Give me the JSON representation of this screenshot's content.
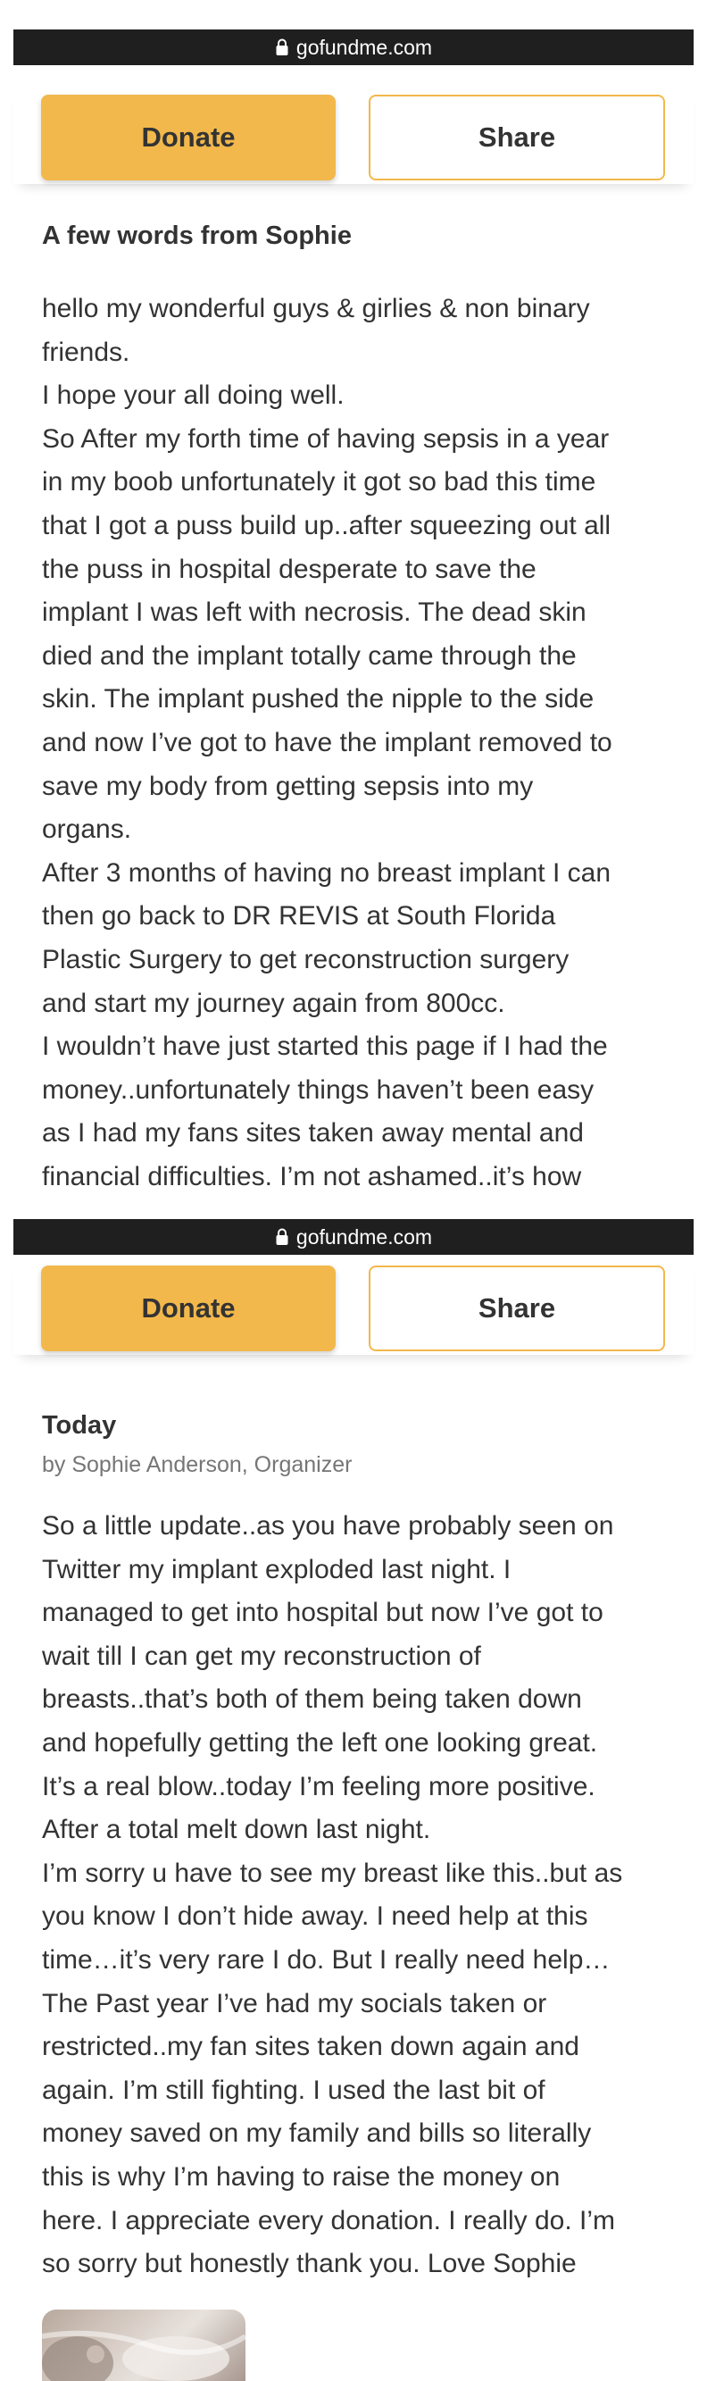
{
  "top_screenshot": {
    "url": "gofundme.com",
    "donate_label": "Donate",
    "share_label": "Share",
    "section_title": "A few words from Sophie",
    "lines": [
      "hello my wonderful guys & girlies & non binary",
      "friends.",
      "I hope your all doing well.",
      "So After my forth time of having sepsis in a year",
      "in my boob unfortunately it got so bad this time",
      "that I got a puss build up..after squeezing out all",
      "the puss in hospital desperate to save the",
      "implant I was left with necrosis. The dead skin",
      "died and the implant totally came through the",
      "skin. The implant pushed the nipple to the side",
      "and now I’ve got to have the implant removed to",
      "save my body from getting sepsis into my",
      "organs.",
      "After 3 months of having no breast implant I can",
      "then go back to DR REVIS at South Florida",
      "Plastic Surgery to get reconstruction surgery",
      "and start my journey again from 800cc.",
      "I wouldn’t have just started this page if I had the",
      "money..unfortunately things haven’t been easy",
      "as I had my fans sites taken away mental and",
      "financial difficulties. I’m not ashamed..it’s how"
    ]
  },
  "bottom_screenshot": {
    "url": "gofundme.com",
    "donate_label": "Donate",
    "share_label": "Share",
    "update_title": "Today",
    "update_byline": "by Sophie Anderson, Organizer",
    "lines": [
      "So a little update..as you have probably seen on",
      "Twitter my implant exploded last night. I",
      "managed to get into hospital but now I’ve got to",
      "wait till I can get my reconstruction of",
      "breasts..that’s both of them being taken down",
      "and hopefully getting the left one looking great.",
      "It’s a real blow..today I’m feeling more positive.",
      "After a total melt down last night.",
      "I’m sorry u have to see my breast like this..but as",
      "you know I don’t hide away. I need help at this",
      "time…it’s very rare I do. But I really need help…",
      "The Past year I’ve had my socials taken or",
      "restricted..my fan sites taken down again and",
      "again. I’m still fighting. I used the last bit of",
      "money saved on my family and bills so literally",
      "this is why I’m having to raise the money on",
      "here. I appreciate every donation. I really do. I’m",
      "so sorry but honestly thank you. Love Sophie"
    ]
  },
  "colors": {
    "button_yellow": "#f2b84b",
    "url_bar": "#1f1f1f",
    "text": "#333333",
    "byline": "#767676"
  }
}
